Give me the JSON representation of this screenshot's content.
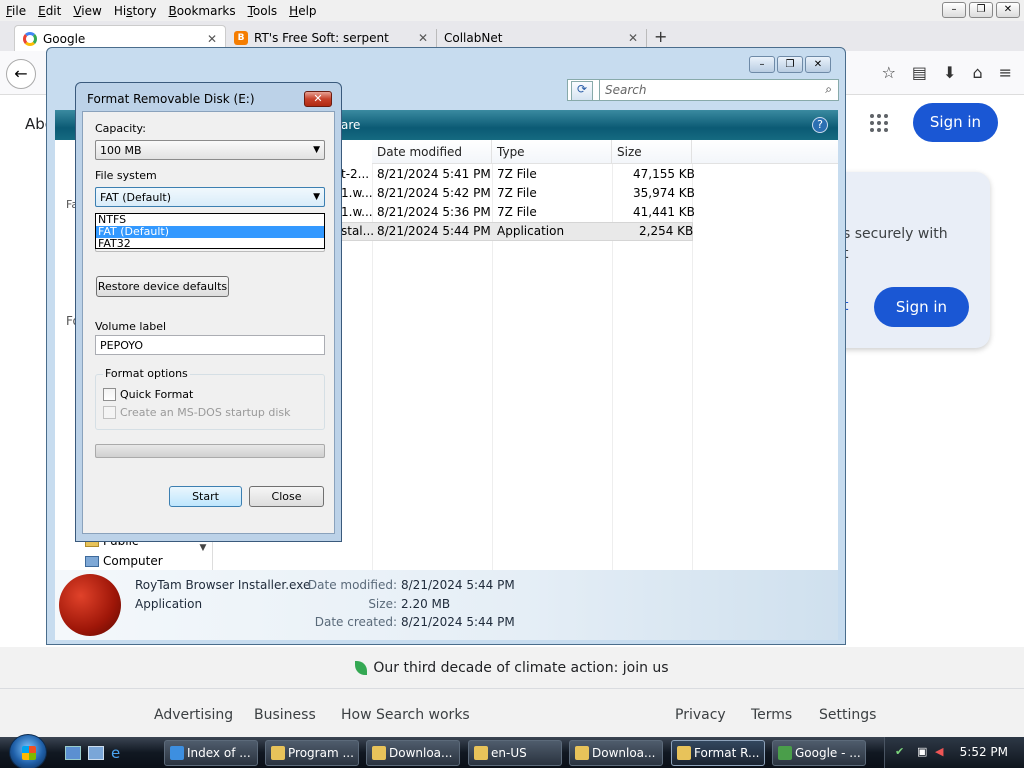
{
  "menu": [
    {
      "pre": "",
      "u": "F",
      "post": "ile"
    },
    {
      "pre": "",
      "u": "E",
      "post": "dit"
    },
    {
      "pre": "",
      "u": "V",
      "post": "iew"
    },
    {
      "pre": "Hi",
      "u": "s",
      "post": "tory"
    },
    {
      "pre": "",
      "u": "B",
      "post": "ookmarks"
    },
    {
      "pre": "",
      "u": "T",
      "post": "ools"
    },
    {
      "pre": "",
      "u": "H",
      "post": "elp"
    }
  ],
  "window_controls": {
    "minimize": "–",
    "restore": "❐",
    "close": "✕"
  },
  "tabs": [
    {
      "title": "Google",
      "icon": "google-icon"
    },
    {
      "title": "RT's Free Soft: serpent",
      "icon": "blogger-icon"
    },
    {
      "title": "CollabNet",
      "icon": ""
    }
  ],
  "tab_close_glyph": "✕",
  "new_tab_glyph": "+",
  "nav": {
    "back": "←",
    "bookmark_star": "☆",
    "reading": "▤",
    "download": "⬇",
    "home": "⌂",
    "menu": "≡"
  },
  "google": {
    "about_partial": "Abo",
    "sign_in_top": "Sign in",
    "popup_text_line1": "s securely with",
    "popup_text_line2": "t",
    "popup_left_partial": "t",
    "sign_in_card": "Sign in",
    "climate": "Our third decade of climate action: join us",
    "footer_left": [
      "Advertising",
      "Business",
      "How Search works"
    ],
    "footer_right": [
      "Privacy",
      "Terms",
      "Settings"
    ]
  },
  "explorer": {
    "search_placeholder": "Search",
    "share_partial": "are",
    "help": "?",
    "nav_items": [
      "Public",
      "Computer"
    ],
    "nav_partial": [
      "Fa",
      "Fo"
    ],
    "columns": [
      "Date modified",
      "Type",
      "Size"
    ],
    "files": [
      {
        "name": "t-2...",
        "date": "8/21/2024 5:41 PM",
        "type": "7Z File",
        "size": "47,155 KB"
      },
      {
        "name": "1.w...",
        "date": "8/21/2024 5:42 PM",
        "type": "7Z File",
        "size": "35,974 KB"
      },
      {
        "name": "1.w...",
        "date": "8/21/2024 5:36 PM",
        "type": "7Z File",
        "size": "41,441 KB"
      },
      {
        "name": "stal...",
        "date": "8/21/2024 5:44 PM",
        "type": "Application",
        "size": "2,254 KB"
      }
    ],
    "details": {
      "filename": "RoyTam Browser Installer.exe",
      "type": "Application",
      "date_modified_label": "Date modified:",
      "date_modified": "8/21/2024 5:44 PM",
      "size_label": "Size:",
      "size": "2.20 MB",
      "date_created_label": "Date created:",
      "date_created": "8/21/2024 5:44 PM"
    }
  },
  "format_dialog": {
    "title": "Format Removable Disk (E:)",
    "close": "✕",
    "capacity_label": "Capacity:",
    "capacity_value": "100 MB",
    "filesystem_label": "File system",
    "filesystem_value": "FAT (Default)",
    "filesystem_options": [
      "NTFS",
      "FAT (Default)",
      "FAT32"
    ],
    "restore_button": "Restore device defaults",
    "volume_label_label": "Volume label",
    "volume_label_value": "PEPOYO",
    "format_options_label": "Format options",
    "quick_format": "Quick Format",
    "msdos_disk": "Create an MS-DOS startup disk",
    "progress": 0,
    "start_button": "Start",
    "close_button": "Close"
  },
  "taskbar": {
    "buttons": [
      {
        "label": "Index of ...",
        "color": "#3d8fe0"
      },
      {
        "label": "Program ...",
        "color": "#e8c35a"
      },
      {
        "label": "Downloa...",
        "color": "#e8c35a"
      },
      {
        "label": "en-US",
        "color": "#e8c35a"
      },
      {
        "label": "Downloa...",
        "color": "#e8c35a"
      },
      {
        "label": "Format R...",
        "color": "#e8c35a"
      },
      {
        "label": "Google - ...",
        "color": "#4a9e4a"
      }
    ],
    "clock": "5:52 PM"
  }
}
